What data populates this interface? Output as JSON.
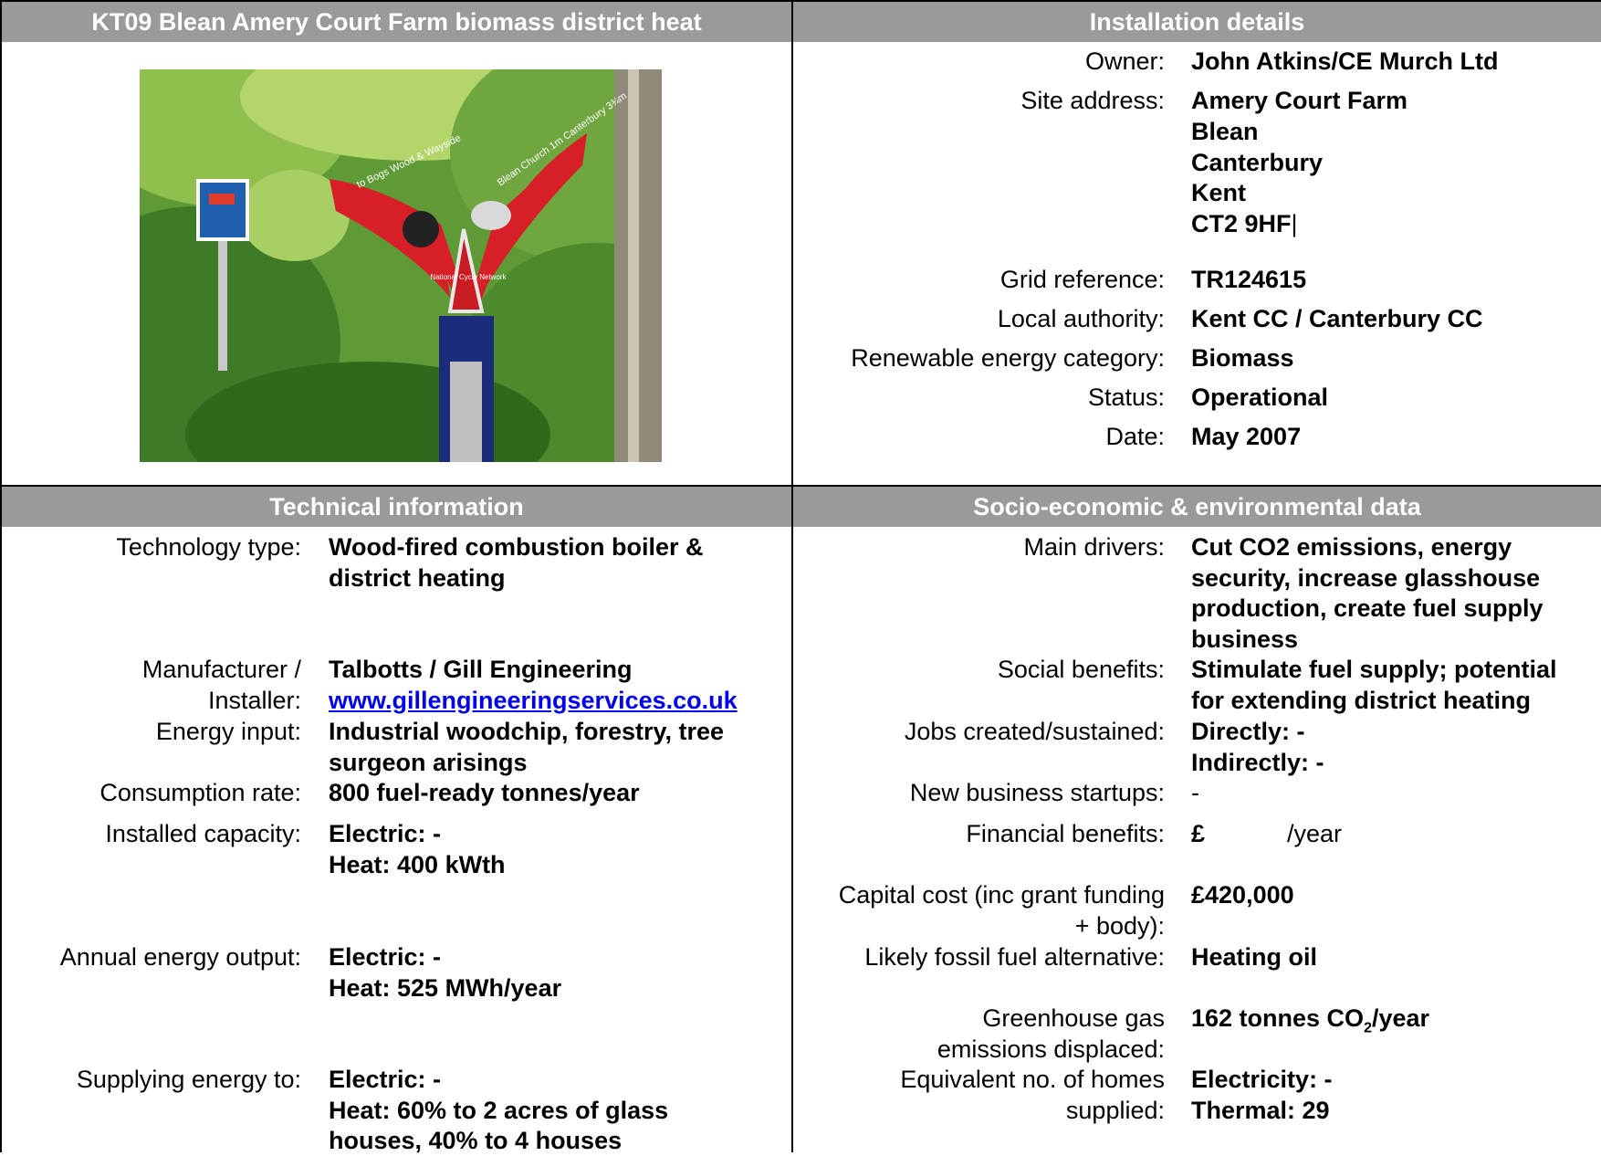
{
  "header": {
    "title": "KT09 Blean Amery Court Farm biomass district heat",
    "installation_title": "Installation details",
    "technical_title": "Technical information",
    "socio_title": "Socio-economic & environmental data"
  },
  "installation": {
    "owner_label": "Owner:",
    "owner": "John Atkins/CE Murch Ltd",
    "address_label": "Site address:",
    "address_lines": [
      "Amery Court Farm",
      "Blean",
      "Canterbury",
      "Kent",
      "CT2 9HF"
    ],
    "address_cursor": "|",
    "grid_label": "Grid reference:",
    "grid": "TR124615",
    "authority_label": "Local authority:",
    "authority": "Kent CC / Canterbury CC",
    "category_label": "Renewable energy category:",
    "category": "Biomass",
    "status_label": "Status:",
    "status": "Operational",
    "date_label": "Date:",
    "date": "May 2007"
  },
  "photo": {
    "sign_left_text": "to Bogs Wood & Wayside",
    "sign_right_text": "Blean Church 1m Canterbury 3¾m",
    "sign_centre_text": "National Cycle Network"
  },
  "technical": {
    "tech_type_label": "Technology type:",
    "tech_type_lines": [
      "Wood-fired combustion boiler &",
      "district heating"
    ],
    "manufacturer_label_1": "Manufacturer /",
    "manufacturer_label_2": "Installer:",
    "manufacturer": "Talbotts / Gill Engineering",
    "manufacturer_link": "www.gillengineeringservices.co.uk",
    "energy_input_label": "Energy input:",
    "energy_input_lines": [
      "Industrial woodchip, forestry, tree",
      "surgeon arisings"
    ],
    "consumption_label": "Consumption rate:",
    "consumption": "800  fuel-ready tonnes/year",
    "capacity_label": "Installed capacity:",
    "capacity_lines": [
      "Electric: -",
      "Heat: 400 kWth"
    ],
    "output_label": "Annual energy output:",
    "output_lines": [
      "Electric: -",
      "Heat:  525 MWh/year"
    ],
    "supplying_label": "Supplying energy to:",
    "supplying_lines": [
      "Electric: -",
      "Heat: 60% to 2 acres of glass",
      "houses, 40% to 4 houses"
    ]
  },
  "socio": {
    "drivers_label": "Main drivers:",
    "drivers_lines": [
      "Cut CO2 emissions, energy",
      "security, increase glasshouse",
      "production, create fuel supply",
      "business"
    ],
    "social_label": "Social benefits:",
    "social_lines": [
      "Stimulate fuel supply; potential",
      "for extending district heating"
    ],
    "jobs_label": "Jobs created/sustained:",
    "jobs_lines": [
      "Directly: -",
      "Indirectly: -"
    ],
    "startups_label": "New business startups:",
    "startups": "-",
    "financial_label": "Financial benefits:",
    "financial_currency": "£",
    "financial_unit": "/year",
    "capital_label_1": "Capital cost (inc grant funding",
    "capital_label_2": "+ body):",
    "capital": "£420,000",
    "fossil_label": "Likely fossil fuel alternative:",
    "fossil": "Heating oil",
    "ghg_label_1": "Greenhouse gas",
    "ghg_label_2": "emissions displaced:",
    "ghg_prefix": "162 tonnes CO",
    "ghg_sub": "2",
    "ghg_suffix": "/year",
    "homes_label_1": "Equivalent no. of homes",
    "homes_label_2": "supplied:",
    "homes_lines": [
      "Electricity: -",
      "Thermal: 29"
    ]
  },
  "colors": {
    "header_bg": "#9a9a9a",
    "header_text": "#ffffff",
    "link": "#0000ee"
  }
}
